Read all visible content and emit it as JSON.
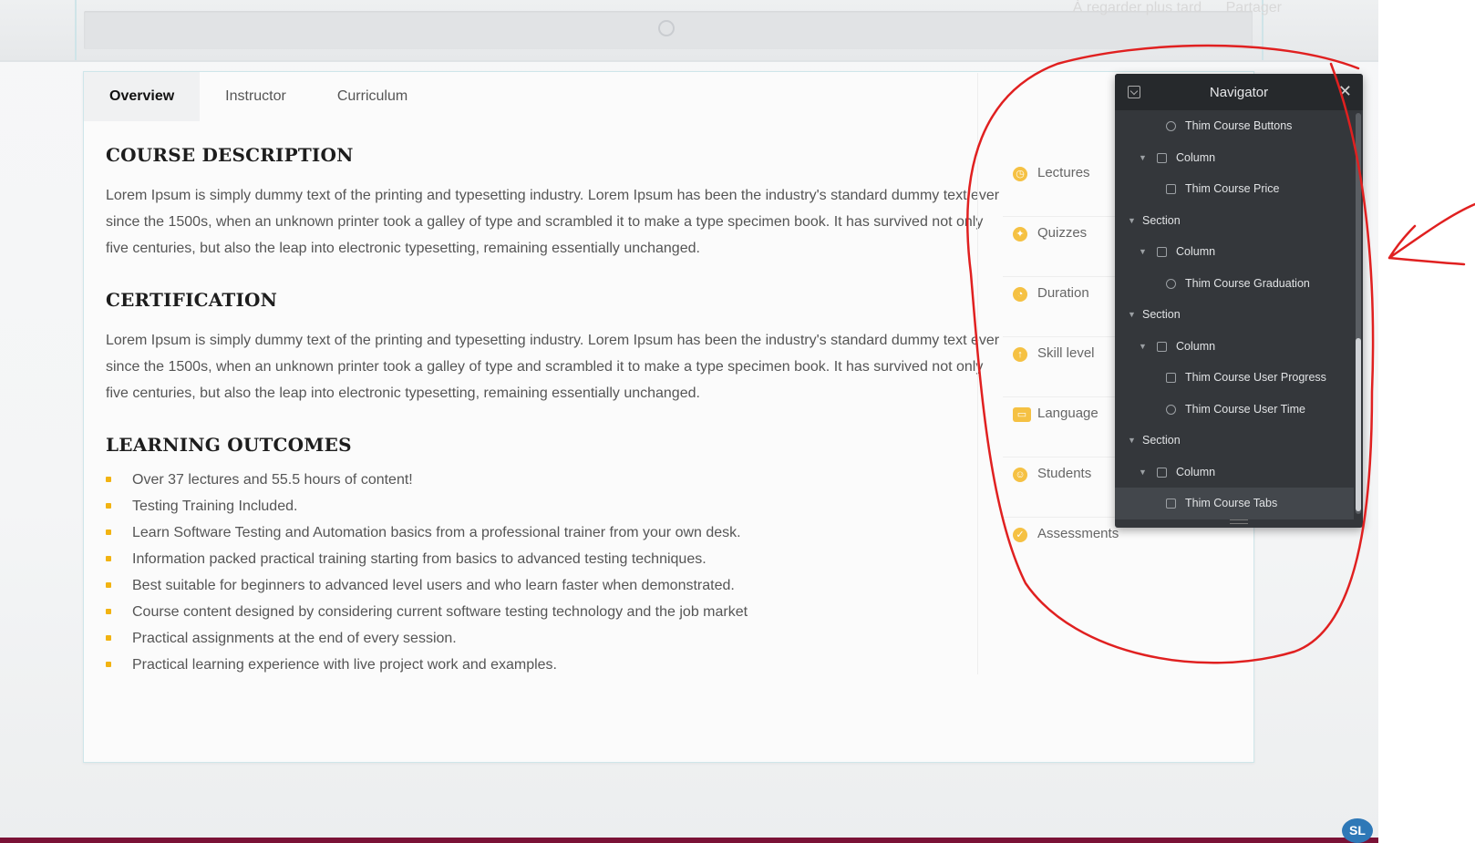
{
  "overlay": {
    "watch_later": "À regarder plus tard",
    "share": "Partager"
  },
  "tabs": [
    {
      "label": "Overview"
    },
    {
      "label": "Instructor"
    },
    {
      "label": "Curriculum"
    }
  ],
  "course": {
    "description": {
      "heading": "COURSE DESCRIPTION",
      "text": "Lorem Ipsum is simply dummy text of the printing and typesetting industry. Lorem Ipsum has been the industry's standard dummy text ever since the 1500s, when an unknown printer took a galley of type and scrambled it to make a type specimen book. It has survived not only five centuries, but also the leap into electronic typesetting, remaining essentially unchanged."
    },
    "certification": {
      "heading": "CERTIFICATION",
      "text": "Lorem Ipsum is simply dummy text of the printing and typesetting industry. Lorem Ipsum has been the industry's standard dummy text ever since the 1500s, when an unknown printer took a galley of type and scrambled it to make a type specimen book. It has survived not only five centuries, but also the leap into electronic typesetting, remaining essentially unchanged."
    },
    "outcomes": {
      "heading": "LEARNING OUTCOMES",
      "items": [
        "Over 37 lectures and 55.5 hours of content!",
        "Testing Training Included.",
        "Learn Software Testing and Automation basics from a professional trainer from your own desk.",
        "Information packed practical training starting from basics to advanced testing techniques.",
        "Best suitable for beginners to advanced level users and who learn faster when demonstrated.",
        "Course content designed by considering current software testing technology and the job market",
        "Practical assignments at the end of every session.",
        "Practical learning experience with live project work and examples."
      ]
    }
  },
  "side_info": [
    {
      "label": "Lectures",
      "icon": "lectures-icon"
    },
    {
      "label": "Quizzes",
      "icon": "quizzes-icon"
    },
    {
      "label": "Duration",
      "icon": "duration-icon"
    },
    {
      "label": "Skill level",
      "icon": "skill-level-icon"
    },
    {
      "label": "Language",
      "icon": "language-icon"
    },
    {
      "label": "Students",
      "icon": "students-icon"
    },
    {
      "label": "Assessments",
      "icon": "assessments-icon"
    }
  ],
  "navigator": {
    "title": "Navigator",
    "items": [
      {
        "label": "Thim Course Buttons",
        "level": 2,
        "type": "widget"
      },
      {
        "label": "Column",
        "level": 1,
        "type": "column"
      },
      {
        "label": "Thim Course Price",
        "level": 2,
        "type": "widget"
      },
      {
        "label": "Section",
        "level": 0,
        "type": "section"
      },
      {
        "label": "Column",
        "level": 1,
        "type": "column"
      },
      {
        "label": "Thim Course Graduation",
        "level": 2,
        "type": "widget"
      },
      {
        "label": "Section",
        "level": 0,
        "type": "section"
      },
      {
        "label": "Column",
        "level": 1,
        "type": "column"
      },
      {
        "label": "Thim Course User Progress",
        "level": 2,
        "type": "widget"
      },
      {
        "label": "Thim Course User Time",
        "level": 2,
        "type": "widget"
      },
      {
        "label": "Section",
        "level": 0,
        "type": "section"
      },
      {
        "label": "Column",
        "level": 1,
        "type": "column"
      },
      {
        "label": "Thim Course Tabs",
        "level": 2,
        "type": "widget",
        "selected": true
      }
    ]
  },
  "avatar": {
    "initials": "SL"
  },
  "colors": {
    "bullet": "#f2b312",
    "annotation": "#e02020",
    "navigator_bg": "#34373b",
    "bottom_bar": "#7a1236"
  }
}
